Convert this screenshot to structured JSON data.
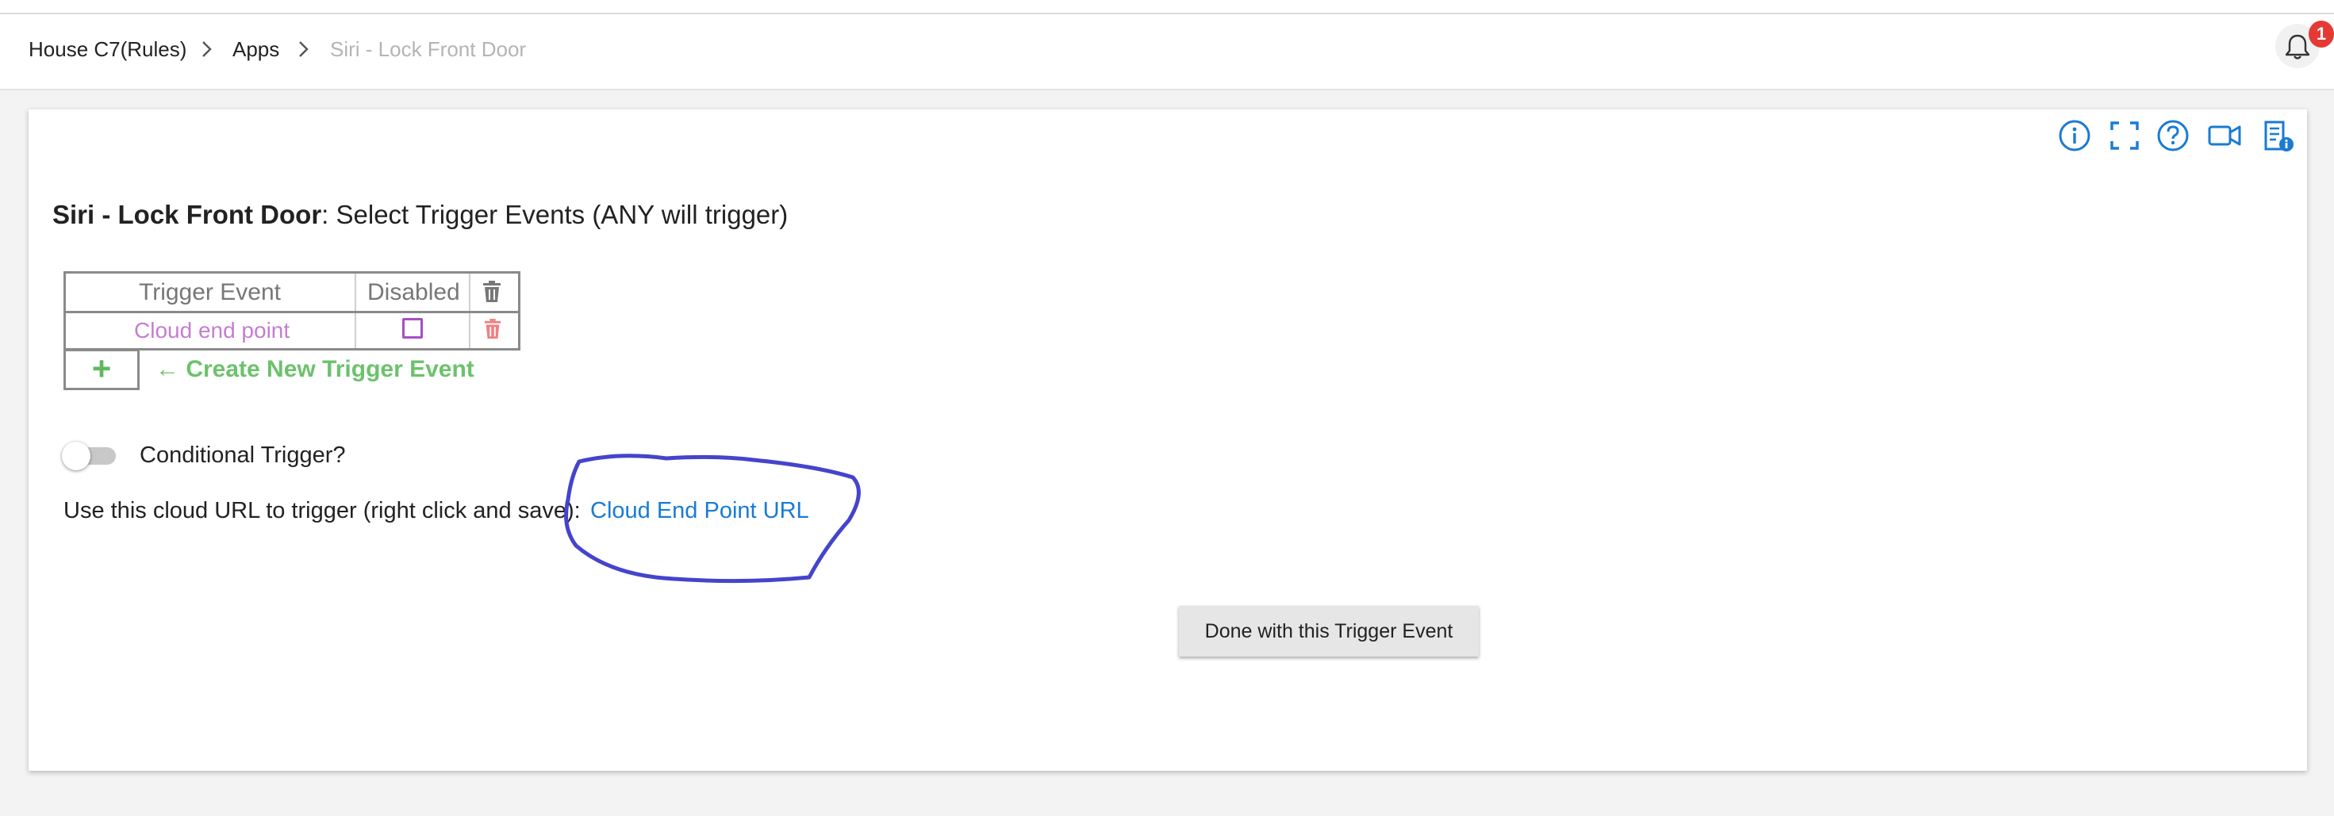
{
  "breadcrumb": {
    "items": [
      "House C7(Rules)",
      "Apps",
      "Siri - Lock Front Door"
    ]
  },
  "notifications": {
    "count": "1"
  },
  "toolbar": {
    "icons": [
      "info-icon",
      "fullscreen-icon",
      "help-icon",
      "video-icon",
      "app-info-icon"
    ]
  },
  "page": {
    "title_bold": "Siri - Lock Front Door",
    "title_rest": ": Select Trigger Events (ANY will trigger)"
  },
  "trigger_table": {
    "headers": [
      "Trigger Event",
      "Disabled"
    ],
    "rows": [
      {
        "event": "Cloud end point",
        "disabled": false
      }
    ]
  },
  "create": {
    "plus": "+",
    "label": "← Create New Trigger Event"
  },
  "conditional": {
    "label": "Conditional Trigger?",
    "enabled": false
  },
  "cloud": {
    "text": "Use this cloud URL to trigger (right click and save):",
    "link": "Cloud End Point URL"
  },
  "done_button": "Done with this Trigger Event",
  "colors": {
    "link_blue": "#1a7bd2",
    "green": "#6cc26c",
    "purple_text": "#c47ed1",
    "annotation": "#4444cc",
    "badge_red": "#e53935"
  }
}
